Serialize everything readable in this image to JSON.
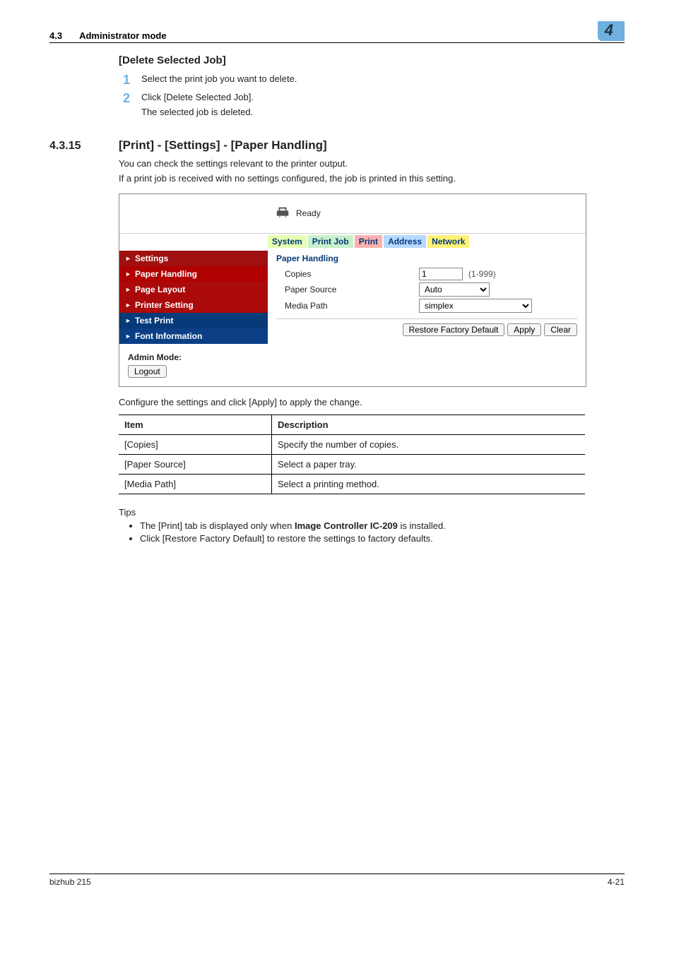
{
  "header": {
    "section_num": "4.3",
    "section_title": "Administrator mode",
    "chapter_badge": "4"
  },
  "delete_job": {
    "heading": "[Delete Selected Job]",
    "step1": "Select the print job you want to delete.",
    "step2": "Click [Delete Selected Job].",
    "step2_sub": "The selected job is deleted."
  },
  "section": {
    "num": "4.3.15",
    "title": "[Print] - [Settings] - [Paper Handling]",
    "para1": "You can check the settings relevant to the printer output.",
    "para2": "If a print job is received with no settings configured, the job is printed in this setting."
  },
  "ui": {
    "status": "Ready",
    "tabs": {
      "system": "System",
      "printjob": "Print Job",
      "print": "Print",
      "address": "Address",
      "network": "Network"
    },
    "sidebar": {
      "settings": "Settings",
      "paper_handling": "Paper Handling",
      "page_layout": "Page Layout",
      "printer_setting": "Printer Setting",
      "test_print": "Test Print",
      "font_info": "Font Information"
    },
    "content": {
      "title": "Paper Handling",
      "copies_label": "Copies",
      "copies_value": "1",
      "copies_range": "(1-999)",
      "paper_source_label": "Paper Source",
      "paper_source_value": "Auto",
      "media_path_label": "Media Path",
      "media_path_value": "simplex",
      "restore_btn": "Restore Factory Default",
      "apply_btn": "Apply",
      "clear_btn": "Clear"
    },
    "admin": {
      "label": "Admin Mode:",
      "logout_btn": "Logout"
    }
  },
  "after_ui": "Configure the settings and click [Apply] to apply the change.",
  "table": {
    "head_item": "Item",
    "head_desc": "Description",
    "r1_item": "[Copies]",
    "r1_desc": "Specify the number of copies.",
    "r2_item": "[Paper Source]",
    "r2_desc": "Select a paper tray.",
    "r3_item": "[Media Path]",
    "r3_desc": "Select a printing method."
  },
  "tips": {
    "label": "Tips",
    "t1_a": "The [Print] tab is displayed only when ",
    "t1_bold": "Image Controller IC-209",
    "t1_b": " is installed.",
    "t2": "Click [Restore Factory Default] to restore the settings to factory defaults."
  },
  "footer": {
    "left": "bizhub 215",
    "right": "4-21"
  }
}
